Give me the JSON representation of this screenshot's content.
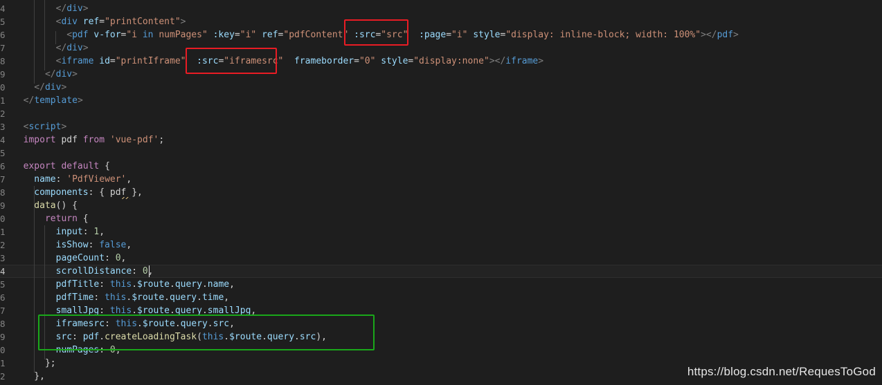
{
  "line_numbers": [
    "4",
    "5",
    "6",
    "7",
    "8",
    "9",
    "0",
    "1",
    "2",
    "3",
    "4",
    "5",
    "6",
    "7",
    "8",
    "9",
    "0",
    "1",
    "2",
    "3",
    "4",
    "5",
    "6",
    "7",
    "8",
    "9",
    "0",
    "1",
    "2"
  ],
  "lines": [
    [
      [
        "t-punc",
        "        </"
      ],
      [
        "t-tag",
        "div"
      ],
      [
        "t-punc",
        ">"
      ]
    ],
    [
      [
        "t-punc",
        "        <"
      ],
      [
        "t-tag",
        "div "
      ],
      [
        "t-attr",
        "ref"
      ],
      [
        "t-plain",
        "="
      ],
      [
        "t-str",
        "\"printContent\""
      ],
      [
        "t-punc",
        ">"
      ]
    ],
    [
      [
        "t-punc",
        "          <"
      ],
      [
        "t-tag",
        "pdf "
      ],
      [
        "t-attr",
        "v-for"
      ],
      [
        "t-plain",
        "="
      ],
      [
        "t-str",
        "\"i "
      ],
      [
        "t-kw2",
        "in"
      ],
      [
        "t-str",
        " numPages\" "
      ],
      [
        "t-attr",
        ":key"
      ],
      [
        "t-plain",
        "="
      ],
      [
        "t-str",
        "\"i\" "
      ],
      [
        "t-attr",
        "ref"
      ],
      [
        "t-plain",
        "="
      ],
      [
        "t-str",
        "\"pdfContent\" "
      ],
      [
        "t-attr",
        ":src"
      ],
      [
        "t-plain",
        "="
      ],
      [
        "t-str",
        "\"src\"  "
      ],
      [
        "t-attr",
        ":page"
      ],
      [
        "t-plain",
        "="
      ],
      [
        "t-str",
        "\"i\" "
      ],
      [
        "t-attr",
        "style"
      ],
      [
        "t-plain",
        "="
      ],
      [
        "t-str",
        "\"display: inline-block; width: 100%\""
      ],
      [
        "t-punc",
        "></"
      ],
      [
        "t-tag",
        "pdf"
      ],
      [
        "t-punc",
        ">"
      ]
    ],
    [
      [
        "t-punc",
        "        </"
      ],
      [
        "t-tag",
        "div"
      ],
      [
        "t-punc",
        ">"
      ]
    ],
    [
      [
        "t-punc",
        "        <"
      ],
      [
        "t-tag",
        "iframe "
      ],
      [
        "t-attr",
        "id"
      ],
      [
        "t-plain",
        "="
      ],
      [
        "t-str",
        "\"printIframe\"  "
      ],
      [
        "t-attr",
        ":src"
      ],
      [
        "t-plain",
        "="
      ],
      [
        "t-str",
        "\"iframesrc\"  "
      ],
      [
        "t-attr",
        "frameborder"
      ],
      [
        "t-plain",
        "="
      ],
      [
        "t-str",
        "\"0\" "
      ],
      [
        "t-attr",
        "style"
      ],
      [
        "t-plain",
        "="
      ],
      [
        "t-str",
        "\"display:none\""
      ],
      [
        "t-punc",
        "></"
      ],
      [
        "t-tag",
        "iframe"
      ],
      [
        "t-punc",
        ">"
      ]
    ],
    [
      [
        "t-punc",
        "      </"
      ],
      [
        "t-tag",
        "div"
      ],
      [
        "t-punc",
        ">"
      ]
    ],
    [
      [
        "t-punc",
        "    </"
      ],
      [
        "t-tag",
        "div"
      ],
      [
        "t-punc",
        ">"
      ]
    ],
    [
      [
        "t-punc",
        "  </"
      ],
      [
        "t-tag",
        "template"
      ],
      [
        "t-punc",
        ">"
      ]
    ],
    [],
    [
      [
        "t-punc",
        "  <"
      ],
      [
        "t-tag",
        "script"
      ],
      [
        "t-punc",
        ">"
      ]
    ],
    [
      [
        "t-kw",
        "  import "
      ],
      [
        "t-plain",
        "pdf "
      ],
      [
        "t-kw",
        "from "
      ],
      [
        "t-str",
        "'vue-pdf'"
      ],
      [
        "t-plain",
        ";"
      ]
    ],
    [],
    [
      [
        "t-kw",
        "  export default "
      ],
      [
        "t-plain",
        "{"
      ]
    ],
    [
      [
        "t-prop",
        "    name"
      ],
      [
        "t-plain",
        ": "
      ],
      [
        "t-str",
        "'PdfViewer'"
      ],
      [
        "t-plain",
        ","
      ]
    ],
    [
      [
        "t-prop",
        "    components"
      ],
      [
        "t-plain",
        ": { pdf },"
      ]
    ],
    [
      [
        "t-fnname",
        "    data"
      ],
      [
        "t-plain",
        "() {"
      ]
    ],
    [
      [
        "t-kw",
        "      return "
      ],
      [
        "t-plain",
        "{"
      ]
    ],
    [
      [
        "t-prop",
        "        input"
      ],
      [
        "t-plain",
        ": "
      ],
      [
        "t-num",
        "1"
      ],
      [
        "t-plain",
        ","
      ]
    ],
    [
      [
        "t-prop",
        "        isShow"
      ],
      [
        "t-plain",
        ": "
      ],
      [
        "t-kw2",
        "false"
      ],
      [
        "t-plain",
        ","
      ]
    ],
    [
      [
        "t-prop",
        "        pageCount"
      ],
      [
        "t-plain",
        ": "
      ],
      [
        "t-num",
        "0"
      ],
      [
        "t-plain",
        ","
      ]
    ],
    [
      [
        "t-prop",
        "        scrollDistance"
      ],
      [
        "t-plain",
        ": "
      ],
      [
        "t-num",
        "0"
      ],
      [
        "t-plain",
        ","
      ]
    ],
    [
      [
        "t-prop",
        "        pdfTitle"
      ],
      [
        "t-plain",
        ": "
      ],
      [
        "t-kw2",
        "this"
      ],
      [
        "t-plain",
        "."
      ],
      [
        "t-prop",
        "$route"
      ],
      [
        "t-plain",
        "."
      ],
      [
        "t-prop",
        "query"
      ],
      [
        "t-plain",
        "."
      ],
      [
        "t-prop",
        "name"
      ],
      [
        "t-plain",
        ","
      ]
    ],
    [
      [
        "t-prop",
        "        pdfTime"
      ],
      [
        "t-plain",
        ": "
      ],
      [
        "t-kw2",
        "this"
      ],
      [
        "t-plain",
        "."
      ],
      [
        "t-prop",
        "$route"
      ],
      [
        "t-plain",
        "."
      ],
      [
        "t-prop",
        "query"
      ],
      [
        "t-plain",
        "."
      ],
      [
        "t-prop",
        "time"
      ],
      [
        "t-plain",
        ","
      ]
    ],
    [
      [
        "t-prop",
        "        smallJpg"
      ],
      [
        "t-plain",
        ": "
      ],
      [
        "t-kw2",
        "this"
      ],
      [
        "t-plain",
        "."
      ],
      [
        "t-prop",
        "$route"
      ],
      [
        "t-plain",
        "."
      ],
      [
        "t-prop",
        "query"
      ],
      [
        "t-plain",
        "."
      ],
      [
        "t-prop",
        "smallJpg"
      ],
      [
        "t-plain",
        ","
      ]
    ],
    [
      [
        "t-prop",
        "        iframesrc"
      ],
      [
        "t-plain",
        ": "
      ],
      [
        "t-kw2",
        "this"
      ],
      [
        "t-plain",
        "."
      ],
      [
        "t-prop",
        "$route"
      ],
      [
        "t-plain",
        "."
      ],
      [
        "t-prop",
        "query"
      ],
      [
        "t-plain",
        "."
      ],
      [
        "t-prop",
        "src"
      ],
      [
        "t-plain",
        ","
      ]
    ],
    [
      [
        "t-prop",
        "        src"
      ],
      [
        "t-plain",
        ": "
      ],
      [
        "t-prop",
        "pdf"
      ],
      [
        "t-plain",
        "."
      ],
      [
        "t-fn",
        "createLoadingTask"
      ],
      [
        "t-plain",
        "("
      ],
      [
        "t-kw2",
        "this"
      ],
      [
        "t-plain",
        "."
      ],
      [
        "t-prop",
        "$route"
      ],
      [
        "t-plain",
        "."
      ],
      [
        "t-prop",
        "query"
      ],
      [
        "t-plain",
        "."
      ],
      [
        "t-prop",
        "src"
      ],
      [
        "t-plain",
        "),"
      ]
    ],
    [
      [
        "t-prop",
        "        numPages"
      ],
      [
        "t-plain",
        ": "
      ],
      [
        "t-num",
        "0"
      ],
      [
        "t-plain",
        ","
      ]
    ],
    [
      [
        "t-plain",
        "      };"
      ]
    ],
    [
      [
        "t-plain",
        "    },"
      ]
    ]
  ],
  "watermark": "https://blog.csdn.net/RequesToGod",
  "colors": {
    "background": "#1e1e1e",
    "highlight_red": "#ea1c24",
    "highlight_green": "#1aa81a"
  }
}
